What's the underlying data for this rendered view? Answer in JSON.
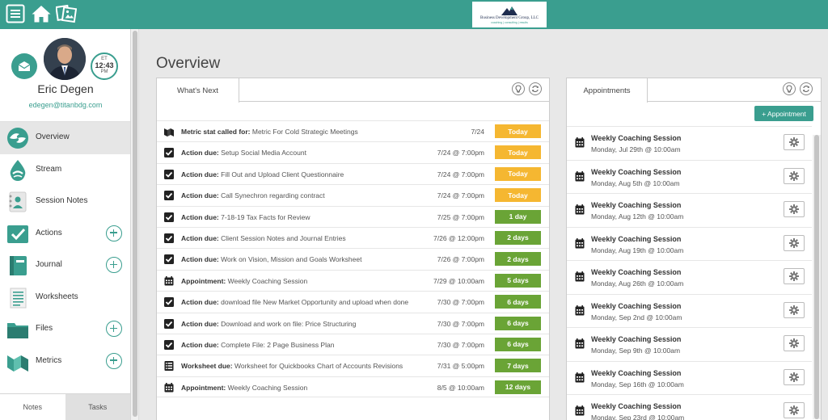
{
  "topbar": {
    "logo_brand": "Business Development Group, LLC",
    "logo_tagline": "coaching | consulting | results"
  },
  "user": {
    "name": "Eric Degen",
    "email": "edegen@titanbdg.com",
    "clock": {
      "tz": "ET",
      "time": "12:43",
      "ampm": "PM"
    }
  },
  "nav": [
    {
      "label": "Overview",
      "icon": "overview-icon",
      "active": true,
      "plus": false
    },
    {
      "label": "Stream",
      "icon": "stream-icon",
      "active": false,
      "plus": false
    },
    {
      "label": "Session Notes",
      "icon": "session-notes-icon",
      "active": false,
      "plus": false
    },
    {
      "label": "Actions",
      "icon": "actions-icon",
      "active": false,
      "plus": true
    },
    {
      "label": "Journal",
      "icon": "journal-icon",
      "active": false,
      "plus": true
    },
    {
      "label": "Worksheets",
      "icon": "worksheets-icon",
      "active": false,
      "plus": false
    },
    {
      "label": "Files",
      "icon": "files-icon",
      "active": false,
      "plus": true
    },
    {
      "label": "Metrics",
      "icon": "metrics-icon",
      "active": false,
      "plus": true
    }
  ],
  "sidebar_tabs": {
    "notes": "Notes",
    "tasks": "Tasks"
  },
  "page": {
    "title": "Overview"
  },
  "whats_next": {
    "tab_label": "What's Next",
    "rows": [
      {
        "icon": "metric-icon",
        "kind": "Metric stat called for:",
        "text": "Metric For Cold Strategic Meetings",
        "date": "7/24",
        "badge": "Today",
        "color": "#f5b731"
      },
      {
        "icon": "check-icon",
        "kind": "Action due:",
        "text": "Setup Social Media Account",
        "date": "7/24 @ 7:00pm",
        "badge": "Today",
        "color": "#f5b731"
      },
      {
        "icon": "check-icon",
        "kind": "Action due:",
        "text": "Fill Out and Upload Client Questionnaire",
        "date": "7/24 @ 7:00pm",
        "badge": "Today",
        "color": "#f5b731"
      },
      {
        "icon": "check-icon",
        "kind": "Action due:",
        "text": "Call Synechron regarding contract",
        "date": "7/24 @ 7:00pm",
        "badge": "Today",
        "color": "#f5b731"
      },
      {
        "icon": "check-icon",
        "kind": "Action due:",
        "text": "7-18-19 Tax Facts for Review",
        "date": "7/25 @ 7:00pm",
        "badge": "1 day",
        "color": "#6aa436"
      },
      {
        "icon": "check-icon",
        "kind": "Action due:",
        "text": "Client Session Notes and Journal Entries",
        "date": "7/26 @ 12:00pm",
        "badge": "2 days",
        "color": "#6aa436"
      },
      {
        "icon": "check-icon",
        "kind": "Action due:",
        "text": "Work on Vision, Mission and Goals Worksheet",
        "date": "7/26 @ 7:00pm",
        "badge": "2 days",
        "color": "#6aa436"
      },
      {
        "icon": "calendar-icon",
        "kind": "Appointment:",
        "text": "Weekly Coaching Session",
        "date": "7/29 @ 10:00am",
        "badge": "5 days",
        "color": "#6aa436"
      },
      {
        "icon": "check-icon",
        "kind": "Action due:",
        "text": "download file New Market Opportunity and upload when done",
        "date": "7/30 @ 7:00pm",
        "badge": "6 days",
        "color": "#6aa436"
      },
      {
        "icon": "check-icon",
        "kind": "Action due:",
        "text": "Download and work on file: Price Structuring",
        "date": "7/30 @ 7:00pm",
        "badge": "6 days",
        "color": "#6aa436"
      },
      {
        "icon": "check-icon",
        "kind": "Action due:",
        "text": "Complete File: 2 Page Business Plan",
        "date": "7/30 @ 7:00pm",
        "badge": "6 days",
        "color": "#6aa436"
      },
      {
        "icon": "worksheet-icon",
        "kind": "Worksheet due:",
        "text": "Worksheet for Quickbooks Chart of Accounts Revisions",
        "date": "7/31 @ 5:00pm",
        "badge": "7 days",
        "color": "#6aa436"
      },
      {
        "icon": "calendar-icon",
        "kind": "Appointment:",
        "text": "Weekly Coaching Session",
        "date": "8/5 @ 10:00am",
        "badge": "12 days",
        "color": "#6aa436"
      }
    ]
  },
  "appointments": {
    "tab_label": "Appointments",
    "add_label": "+ Appointment",
    "rows": [
      {
        "title": "Weekly Coaching Session",
        "time": "Monday, Jul 29th @ 10:00am"
      },
      {
        "title": "Weekly Coaching Session",
        "time": "Monday, Aug 5th @ 10:00am"
      },
      {
        "title": "Weekly Coaching Session",
        "time": "Monday, Aug 12th @ 10:00am"
      },
      {
        "title": "Weekly Coaching Session",
        "time": "Monday, Aug 19th @ 10:00am"
      },
      {
        "title": "Weekly Coaching Session",
        "time": "Monday, Aug 26th @ 10:00am"
      },
      {
        "title": "Weekly Coaching Session",
        "time": "Monday, Sep 2nd @ 10:00am"
      },
      {
        "title": "Weekly Coaching Session",
        "time": "Monday, Sep 9th @ 10:00am"
      },
      {
        "title": "Weekly Coaching Session",
        "time": "Monday, Sep 16th @ 10:00am"
      },
      {
        "title": "Weekly Coaching Session",
        "time": "Monday, Sep 23rd @ 10:00am"
      }
    ]
  },
  "colors": {
    "teal": "#3a9e8f",
    "today": "#f5b731",
    "upcoming": "#6aa436"
  }
}
